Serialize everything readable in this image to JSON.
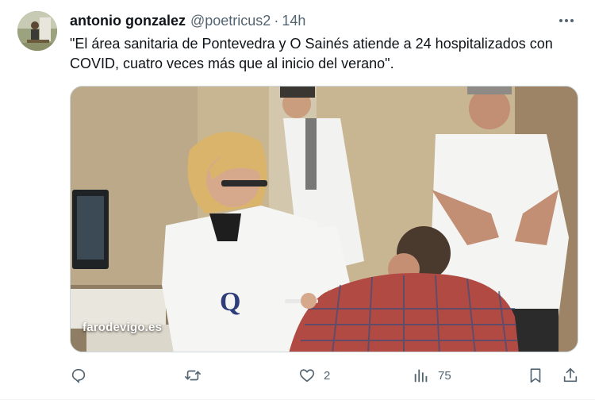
{
  "author": {
    "name": "antonio gonzalez",
    "handle": "@poetricus2",
    "separator": "·",
    "time": "14h"
  },
  "tweet": {
    "text": "\"El área sanitaria de Pontevedra y O Sainés atiende a 24 hospitalizados con COVID, cuatro veces más que al inicio del verano\"."
  },
  "media": {
    "source_label": "farodevigo.es",
    "vest_letter": "Q"
  },
  "actions": {
    "reply": {
      "icon": "reply-icon",
      "count": ""
    },
    "retweet": {
      "icon": "retweet-icon",
      "count": ""
    },
    "like": {
      "icon": "heart-icon",
      "count": "2"
    },
    "views": {
      "icon": "views-chart-icon",
      "count": "75"
    },
    "bookmark": {
      "icon": "bookmark-icon"
    },
    "share": {
      "icon": "share-icon"
    }
  },
  "colors": {
    "text_primary": "#0f1419",
    "text_secondary": "#536471",
    "border": "#cfd9de"
  }
}
